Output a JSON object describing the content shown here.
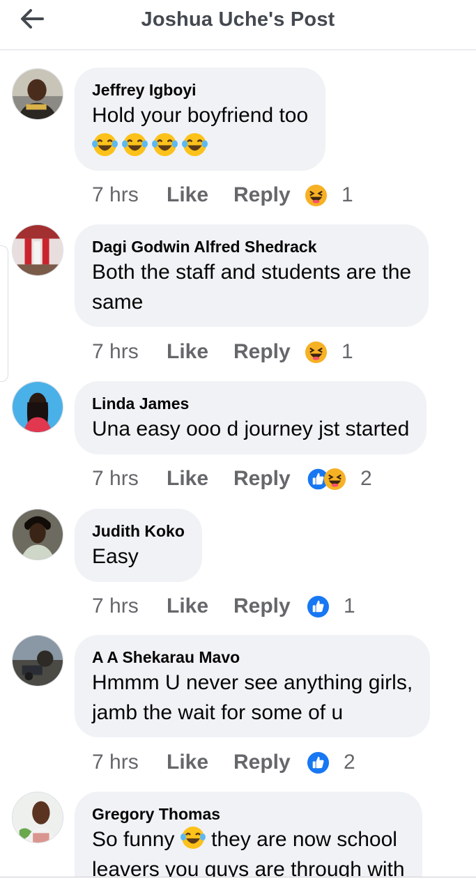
{
  "header": {
    "title": "Joshua Uche's Post",
    "back_icon": "arrow-left-icon"
  },
  "colors": {
    "bubble": "#f0f2f5",
    "meta": "#65676b",
    "like_blue": "#1877f2",
    "haha_yellow": "#f7b125"
  },
  "comments": [
    {
      "author": "Jeffrey Igboyi",
      "lines": [
        "Hold your boyfriend too"
      ],
      "emoji_line": 4,
      "time": "7 hrs",
      "like": "Like",
      "reply": "Reply",
      "reactions": [
        "haha"
      ],
      "count": "1"
    },
    {
      "author": "Dagi Godwin Alfred Shedrack",
      "lines": [
        "Both the staff and students are the",
        "same"
      ],
      "time": "7 hrs",
      "like": "Like",
      "reply": "Reply",
      "reactions": [
        "haha"
      ],
      "count": "1"
    },
    {
      "author": "Linda James",
      "lines": [
        "Una easy ooo d journey jst started"
      ],
      "time": "7 hrs",
      "like": "Like",
      "reply": "Reply",
      "reactions": [
        "like",
        "haha"
      ],
      "count": "2"
    },
    {
      "author": "Judith Koko",
      "lines": [
        "Easy"
      ],
      "time": "7 hrs",
      "like": "Like",
      "reply": "Reply",
      "reactions": [
        "like"
      ],
      "count": "1"
    },
    {
      "author": "A A Shekarau Mavo",
      "lines": [
        "Hmmm U never see anything girls,",
        "jamb the wait for some of u"
      ],
      "time": "7 hrs",
      "like": "Like",
      "reply": "Reply",
      "reactions": [
        "like"
      ],
      "count": "2"
    },
    {
      "author": "Gregory Thomas",
      "lines": [
        "So funny",
        "they are now school",
        "leavers you guys are through with"
      ]
    }
  ]
}
